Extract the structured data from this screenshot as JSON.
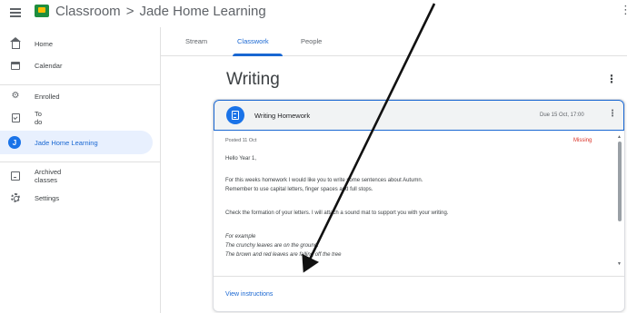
{
  "app": {
    "brand": "Classroom",
    "separator": ">",
    "class_name": "Jade Home Learning"
  },
  "sidebar": {
    "items": [
      {
        "label": "Home",
        "icon": "home-icon"
      },
      {
        "label": "Calendar",
        "icon": "calendar-icon"
      },
      {
        "label": "Enrolled",
        "icon": "enrolled-icon"
      },
      {
        "label": "To do",
        "icon": "todo-icon"
      },
      {
        "label": "Jade Home Learning",
        "icon": "class-avatar",
        "avatar_letter": "J",
        "active": true
      },
      {
        "label": "Archived classes",
        "icon": "archive-icon"
      },
      {
        "label": "Settings",
        "icon": "gear-icon"
      }
    ]
  },
  "tabs": [
    {
      "label": "Stream"
    },
    {
      "label": "Classwork",
      "active": true
    },
    {
      "label": "People"
    }
  ],
  "topic": {
    "title": "Writing"
  },
  "assignment": {
    "title": "Writing Homework",
    "due": "Due 15 Oct, 17:00",
    "posted": "Posted 11 Oct",
    "status": "Missing",
    "lines": [
      "Hello Year 1,",
      "For this weeks homework I would like you to write some sentences about Autumn.",
      "Remember to use capital letters, finger spaces and full stops.",
      "Check the formation of your letters. I will attach a sound mat to support you with your writing.",
      "For example",
      "The crunchy leaves are on the ground.",
      "The brown and red leaves are falling off the tree"
    ],
    "view_link": "View instructions"
  },
  "colors": {
    "accent": "#1967d2",
    "missing": "#d93025",
    "active_bg": "#e8f0fe"
  }
}
